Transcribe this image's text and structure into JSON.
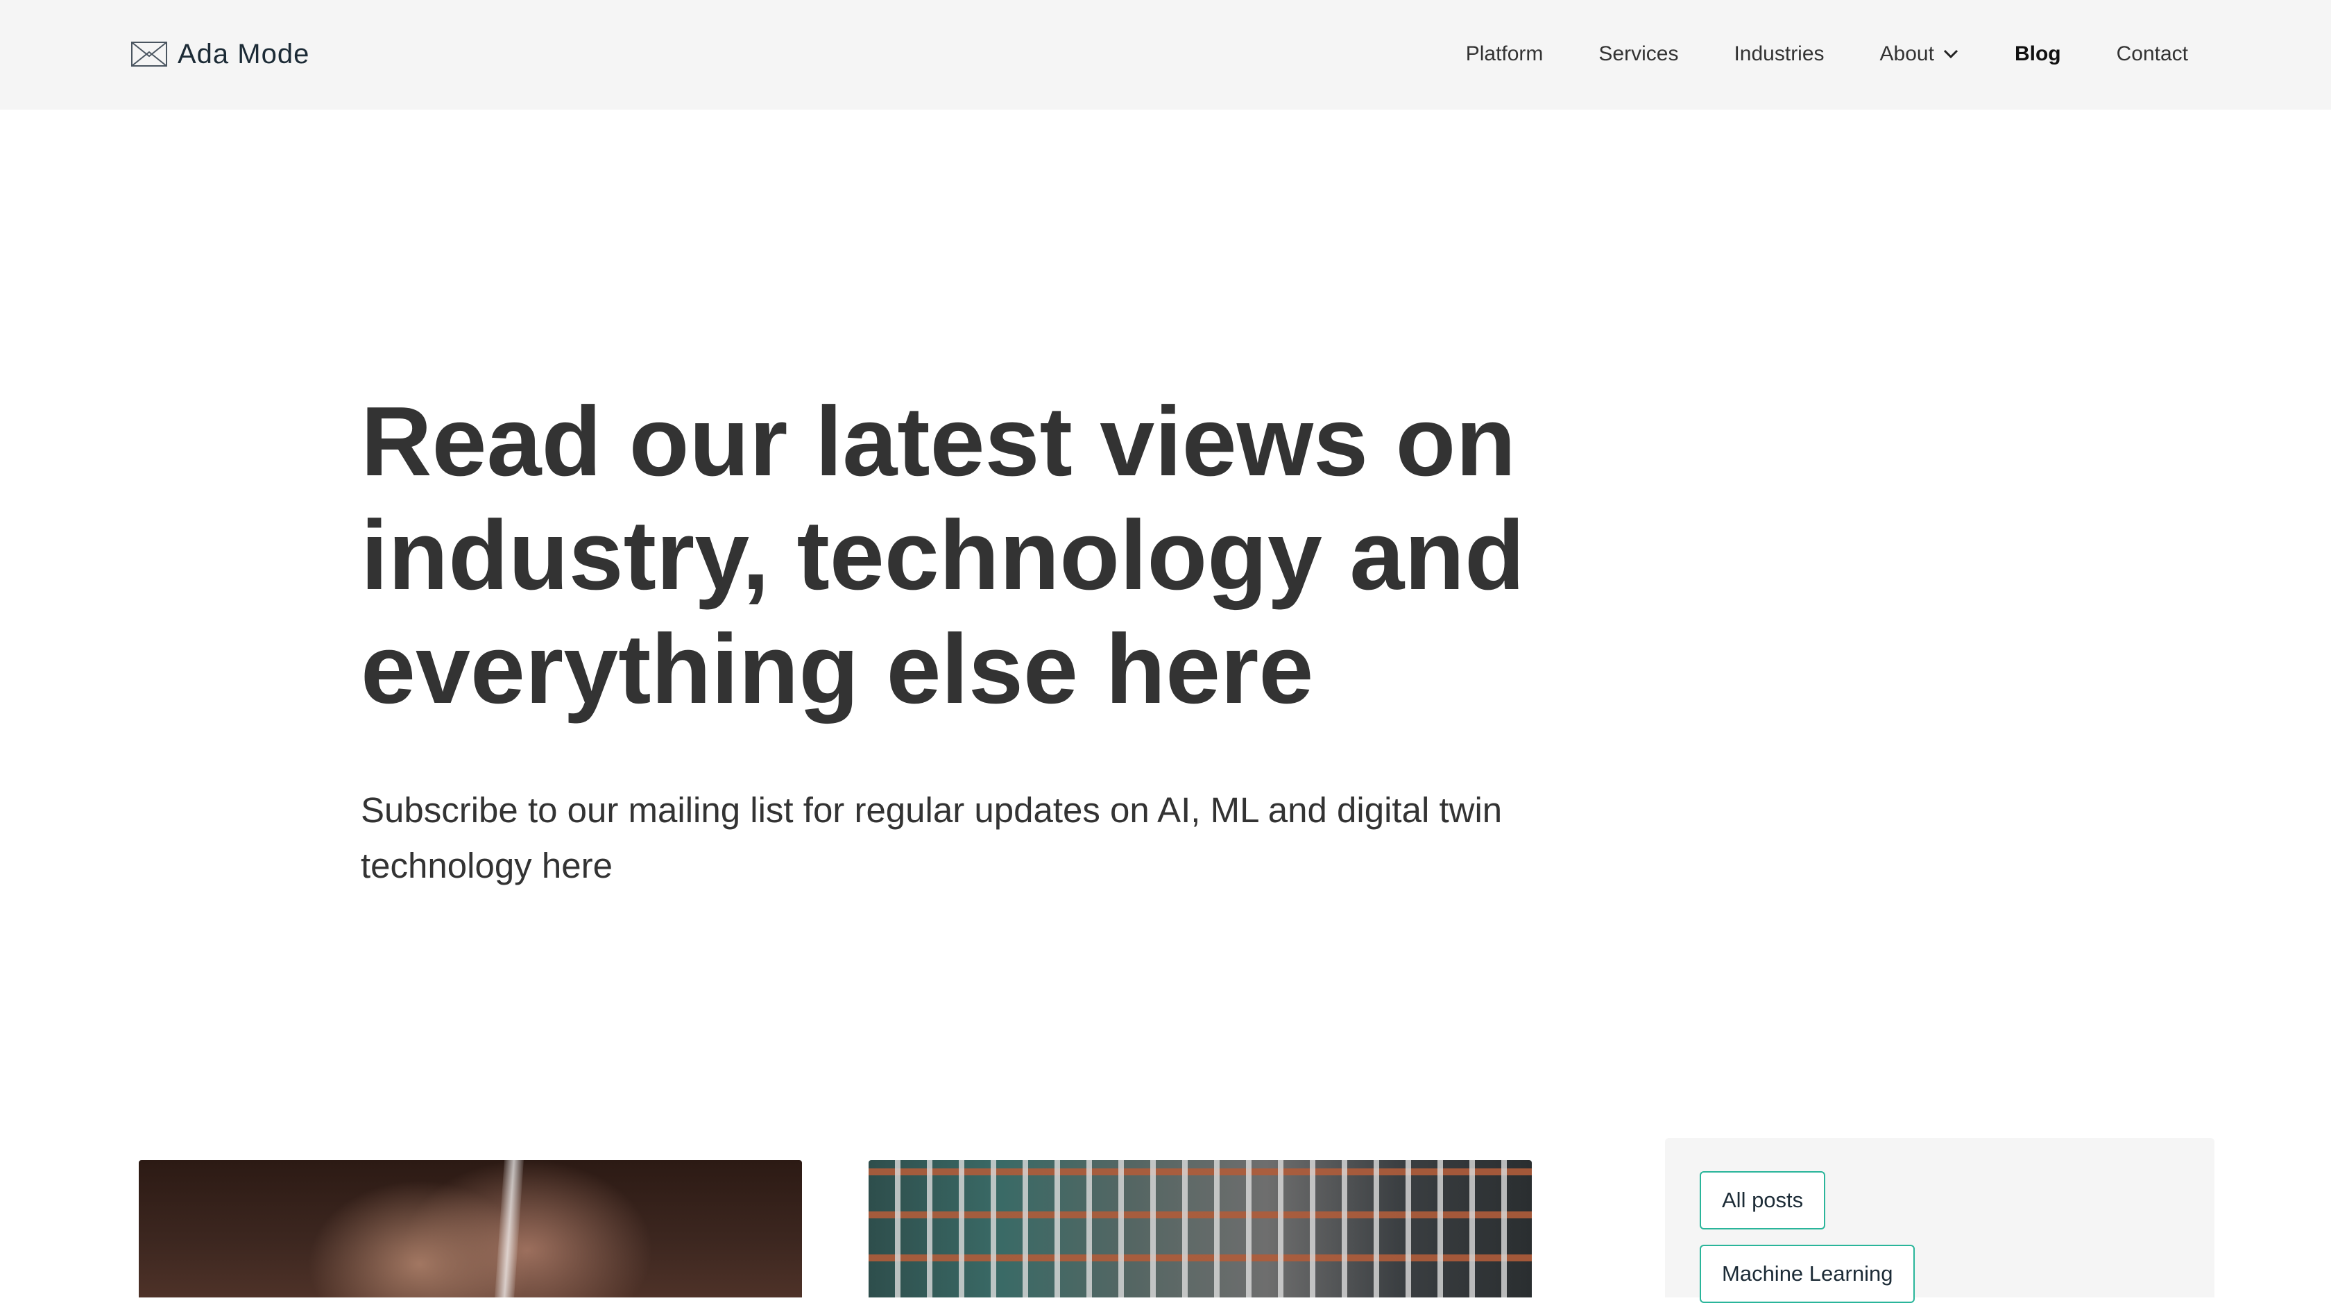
{
  "brand": {
    "name": "Ada Mode"
  },
  "nav": {
    "items": [
      {
        "label": "Platform"
      },
      {
        "label": "Services"
      },
      {
        "label": "Industries"
      },
      {
        "label": "About"
      },
      {
        "label": "Blog"
      },
      {
        "label": "Contact"
      }
    ],
    "active": "Blog"
  },
  "hero": {
    "title_line1": "Read our latest views on",
    "title_line2": "industry, technology and",
    "title_line3": "everything else here",
    "subtitle_line1": "Subscribe to our mailing list for regular updates on AI, ML and digital twin",
    "subtitle_line2": "technology here"
  },
  "sidebar": {
    "tags": [
      {
        "label": "All posts"
      },
      {
        "label": "Machine Learning"
      }
    ]
  },
  "colors": {
    "header_bg": "#f5f5f5",
    "text": "#333333",
    "tag_border": "#2ab59a"
  }
}
